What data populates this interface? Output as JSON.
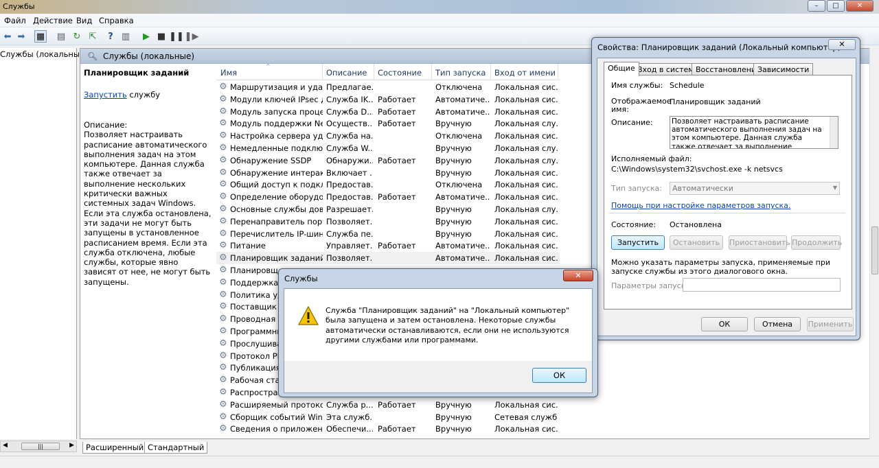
{
  "window": {
    "title": "Службы"
  },
  "menu": [
    "Файл",
    "Действие",
    "Вид",
    "Справка"
  ],
  "tree": {
    "root": "Службы (локальные)"
  },
  "pane": {
    "header": "Службы (локальные)",
    "selected_name": "Планировщик заданий",
    "start_link": "Запустить",
    "start_suffix": " службу",
    "description_label": "Описание:",
    "description_text": "Позволяет настраивать расписание автоматического выполнения задач на этом компьютере. Данная служба также отвечает за выполнение нескольких критически важных системных задач Windows. Если эта служба остановлена, эти задачи не могут быть запущены в установленное расписанием время. Если эта служба отключена, любые службы, которые явно зависят от нее, не могут быть запущены."
  },
  "columns": [
    "Имя",
    "Описание",
    "Состояние",
    "Тип запуска",
    "Вход от имени"
  ],
  "services": [
    [
      "Маршрутизация и удал...",
      "Предлагае...",
      "",
      "Отключена",
      "Локальная сис..."
    ],
    [
      "Модули ключей IPsec д...",
      "Служба IK...",
      "Работает",
      "Автоматиче...",
      "Локальная сис..."
    ],
    [
      "Модуль запуска процес...",
      "Служба D...",
      "Работает",
      "Автоматиче...",
      "Локальная сис..."
    ],
    [
      "Модуль поддержки Net...",
      "Осуществ...",
      "Работает",
      "Вручную",
      "Локальная слу..."
    ],
    [
      "Настройка сервера уда...",
      "Служба на...",
      "",
      "Отключена",
      "Локальная сис..."
    ],
    [
      "Немедленные подключ...",
      "Служба W...",
      "",
      "Вручную",
      "Локальная слу..."
    ],
    [
      "Обнаружение SSDP",
      "Обнаружи...",
      "Работает",
      "Вручную",
      "Локальная слу..."
    ],
    [
      "Обнаружение интеракт...",
      "Включает ...",
      "",
      "Вручную",
      "Локальная сис..."
    ],
    [
      "Общий доступ к подкл...",
      "Предостав...",
      "",
      "Отключена",
      "Локальная сис..."
    ],
    [
      "Определение оборудов...",
      "Предостав...",
      "Работает",
      "Автоматиче...",
      "Локальная сис..."
    ],
    [
      "Основные службы дов...",
      "Разрешает...",
      "",
      "Вручную",
      "Локальная слу..."
    ],
    [
      "Перенаправитель порт...",
      "Позволяет...",
      "",
      "Вручную",
      "Локальная сис..."
    ],
    [
      "Перечислитель IP-шин...",
      "Служба пе...",
      "",
      "Вручную",
      "Локальная сис..."
    ],
    [
      "Питание",
      "Управляет...",
      "Работает",
      "Автоматиче...",
      "Локальная сис..."
    ],
    [
      "Планировщик заданий",
      "Позволяет...",
      "",
      "Автоматиче...",
      "Локальная сис..."
    ],
    [
      "Планировщ",
      "",
      "",
      "",
      ""
    ],
    [
      "Поддержка э",
      "",
      "",
      "",
      ""
    ],
    [
      "Политика уда",
      "",
      "",
      "",
      ""
    ],
    [
      "Поставщик д",
      "",
      "",
      "",
      ""
    ],
    [
      "Проводная ав",
      "",
      "",
      "",
      ""
    ],
    [
      "Программны",
      "",
      "",
      "",
      ""
    ],
    [
      "Прослушива",
      "",
      "",
      "",
      ""
    ],
    [
      "Протокол PN",
      "",
      "",
      "",
      ""
    ],
    [
      "Публикация р",
      "",
      "",
      "",
      ""
    ],
    [
      "Рабочая стан",
      "",
      "",
      "",
      ""
    ],
    [
      "Распростран",
      "",
      "",
      "",
      ""
    ],
    [
      "Расширяемый протоко...",
      "Служба р...",
      "Работает",
      "Вручную",
      "Локальная сис..."
    ],
    [
      "Сборщик событий Win...",
      "Эта служб...",
      "",
      "Вручную",
      "Сетевая служба"
    ],
    [
      "Сведения о приложении",
      "Обеспечи...",
      "Работает",
      "Вручную",
      "Локальная сис..."
    ]
  ],
  "bottom_tabs": [
    "Расширенный",
    "Стандартный"
  ],
  "properties": {
    "title": "Свойства: Планировщик заданий (Локальный компьютер)",
    "tabs": [
      "Общие",
      "Вход в систему",
      "Восстановление",
      "Зависимости"
    ],
    "service_name_label": "Имя службы:",
    "service_name": "Schedule",
    "display_name_label_1": "Отображаемое",
    "display_name_label_2": "имя:",
    "display_name": "Планировщик заданий",
    "description_label": "Описание:",
    "description": "Позволяет настраивать расписание автоматического выполнения задач на этом компьютере. Данная служба также отвечает за выполнение нескольких критически важных",
    "exe_label": "Исполняемый файл:",
    "exe_path": "C:\\Windows\\system32\\svchost.exe -k netsvcs",
    "startup_type_label": "Тип запуска:",
    "startup_type": "Автоматически",
    "help_link": "Помощь при настройке параметров запуска.",
    "state_label": "Состояние:",
    "state": "Остановлена",
    "btn_start": "Запустить",
    "btn_stop": "Остановить",
    "btn_pause": "Приостановить",
    "btn_resume": "Продолжить",
    "params_hint": "Можно указать параметры запуска, применяемые при запуске службы из этого диалогового окна.",
    "params_label": "Параметры запуска:",
    "btn_ok": "ОК",
    "btn_cancel": "Отмена",
    "btn_apply": "Применить"
  },
  "message": {
    "title": "Службы",
    "text": "Служба \"Планировщик заданий\" на \"Локальный компьютер\" была запущена и затем остановлена. Некоторые службы автоматически останавливаются, если они не используются другими службами или программами.",
    "ok": "ОК"
  }
}
